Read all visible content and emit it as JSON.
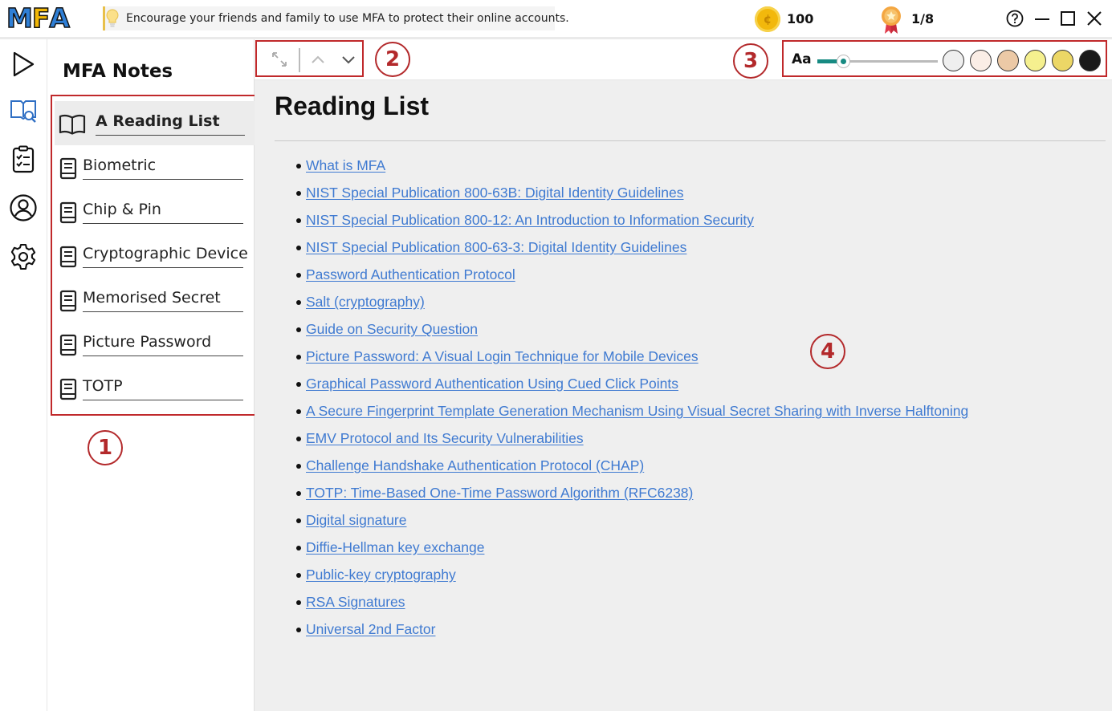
{
  "app": {
    "logo_text": "MFA",
    "logo_colors": [
      "#2f7fd6",
      "#f2b705",
      "#e25a2c"
    ],
    "tip_text": "Encourage your friends and family to use MFA to protect their online accounts.",
    "coins": "100",
    "progress": "1/8"
  },
  "rail": {
    "items": [
      "play",
      "notes",
      "checklist",
      "profile",
      "settings"
    ],
    "active": "notes"
  },
  "sidebar": {
    "title": "MFA Notes",
    "items": [
      {
        "label": "A Reading List",
        "icon": "open-book-icon",
        "active": true
      },
      {
        "label": "Biometric",
        "icon": "book-icon"
      },
      {
        "label": "Chip & Pin",
        "icon": "book-icon"
      },
      {
        "label": "Cryptographic Device",
        "icon": "book-icon"
      },
      {
        "label": "Memorised Secret",
        "icon": "book-icon"
      },
      {
        "label": "Picture Password",
        "icon": "book-icon"
      },
      {
        "label": "TOTP",
        "icon": "book-icon"
      }
    ]
  },
  "toolbar": {
    "font_label": "Aa",
    "font_size_level": 0.22,
    "swatches": [
      "#efefef",
      "#fbeee6",
      "#ecc9a6",
      "#f5f08f",
      "#ecd766",
      "#1a1a1a"
    ]
  },
  "callouts": [
    "1",
    "2",
    "3",
    "4"
  ],
  "content": {
    "title": "Reading List",
    "links": [
      "What is MFA",
      "NIST Special Publication 800-63B: Digital Identity Guidelines",
      "NIST Special Publication 800-12: An Introduction to Information Security",
      "NIST Special Publication 800-63-3: Digital Identity Guidelines",
      "Password Authentication Protocol",
      "Salt (cryptography)",
      "Guide on Security Question",
      "Picture Password: A Visual Login Technique for Mobile Devices",
      "Graphical Password Authentication Using Cued Click Points",
      "A Secure Fingerprint Template Generation Mechanism Using Visual Secret Sharing with Inverse Halftoning",
      "EMV Protocol and Its Security Vulnerabilities",
      "Challenge Handshake Authentication Protocol (CHAP)",
      "TOTP: Time-Based One-Time Password Algorithm (RFC6238)",
      "Digital signature",
      "Diffie-Hellman key exchange",
      "Public-key cryptography",
      "RSA Signatures",
      "Universal 2nd Factor"
    ]
  }
}
